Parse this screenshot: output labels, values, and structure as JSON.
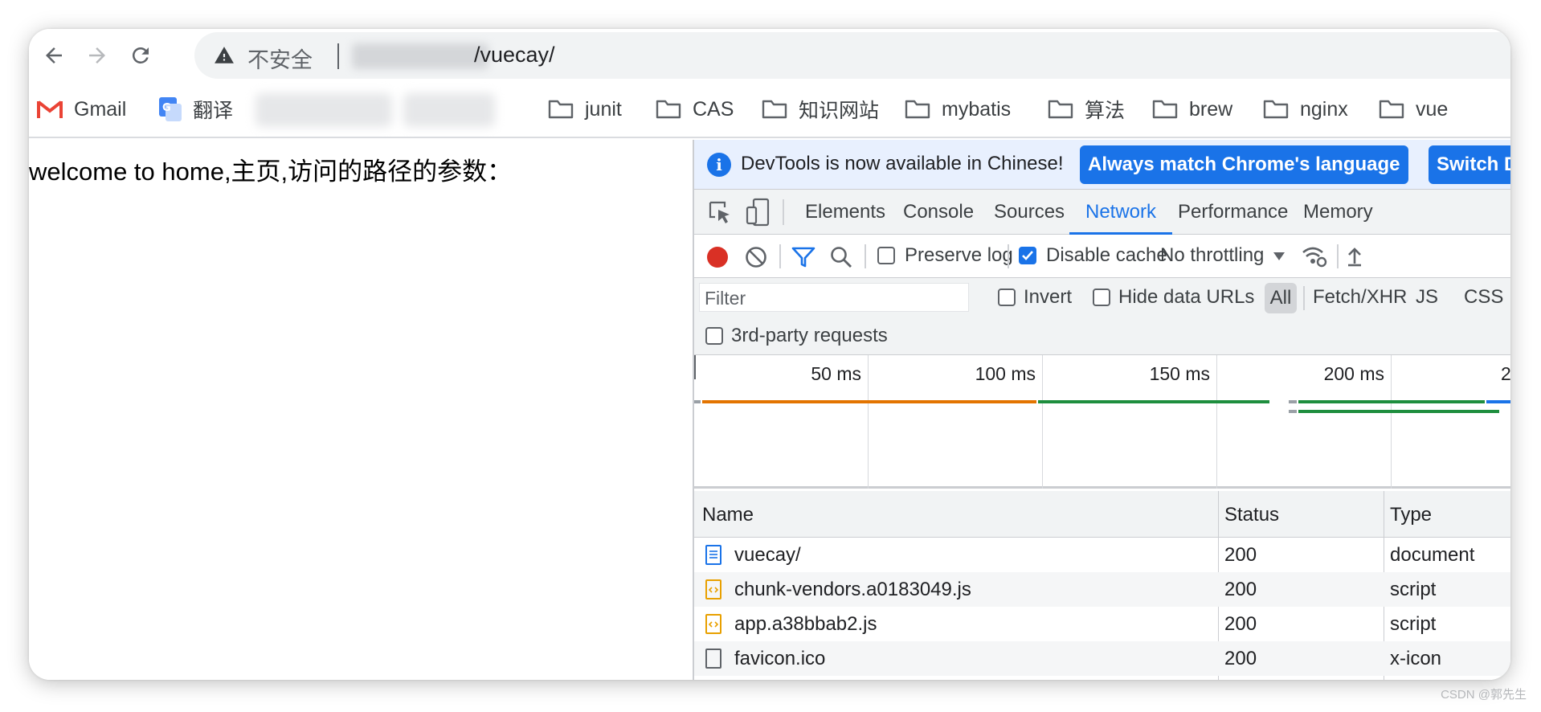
{
  "browser": {
    "omnibox": {
      "security_label": "不安全",
      "url_path": "/vuecay/"
    },
    "bookmarks": [
      {
        "label": "Gmail",
        "icon": "gmail-icon"
      },
      {
        "label": "翻译",
        "icon": "translate-icon"
      },
      {
        "label": "junit",
        "icon": "folder-icon"
      },
      {
        "label": "CAS",
        "icon": "folder-icon"
      },
      {
        "label": "知识网站",
        "icon": "folder-icon"
      },
      {
        "label": "mybatis",
        "icon": "folder-icon"
      },
      {
        "label": "算法",
        "icon": "folder-icon"
      },
      {
        "label": "brew",
        "icon": "folder-icon"
      },
      {
        "label": "nginx",
        "icon": "folder-icon"
      },
      {
        "label": "vue",
        "icon": "folder-icon"
      }
    ]
  },
  "page": {
    "text": "welcome to home,主页,访问的路径的参数："
  },
  "devtools": {
    "banner": {
      "message": "DevTools is now available in Chinese!",
      "btn_match": "Always match Chrome's language",
      "btn_switch": "Switch Dev"
    },
    "tabs": [
      {
        "label": "Elements"
      },
      {
        "label": "Console"
      },
      {
        "label": "Sources"
      },
      {
        "label": "Network",
        "active": true
      },
      {
        "label": "Performance"
      },
      {
        "label": "Memory"
      }
    ],
    "network": {
      "preserve_log": "Preserve log",
      "preserve_log_checked": false,
      "disable_cache": "Disable cache",
      "disable_cache_checked": true,
      "throttling": "No throttling",
      "filter_placeholder": "Filter",
      "invert": "Invert",
      "hide_data_urls": "Hide data URLs",
      "type_filters": [
        "All",
        "Fetch/XHR",
        "JS",
        "CSS"
      ],
      "third_party": "3rd-party requests",
      "timeline_ticks": [
        "50 ms",
        "100 ms",
        "150 ms",
        "200 ms",
        "2"
      ],
      "columns": [
        "Name",
        "Status",
        "Type"
      ],
      "rows": [
        {
          "name": "vuecay/",
          "status": "200",
          "type": "document"
        },
        {
          "name": "chunk-vendors.a0183049.js",
          "status": "200",
          "type": "script"
        },
        {
          "name": "app.a38bbab2.js",
          "status": "200",
          "type": "script"
        },
        {
          "name": "favicon.ico",
          "status": "200",
          "type": "x-icon"
        }
      ]
    }
  },
  "colors": {
    "accent": "#1a73e8",
    "record": "#d93025",
    "waterfall_waiting": "#e37400",
    "waterfall_download": "#1e8e3e"
  },
  "watermark": "CSDN @郭先生"
}
